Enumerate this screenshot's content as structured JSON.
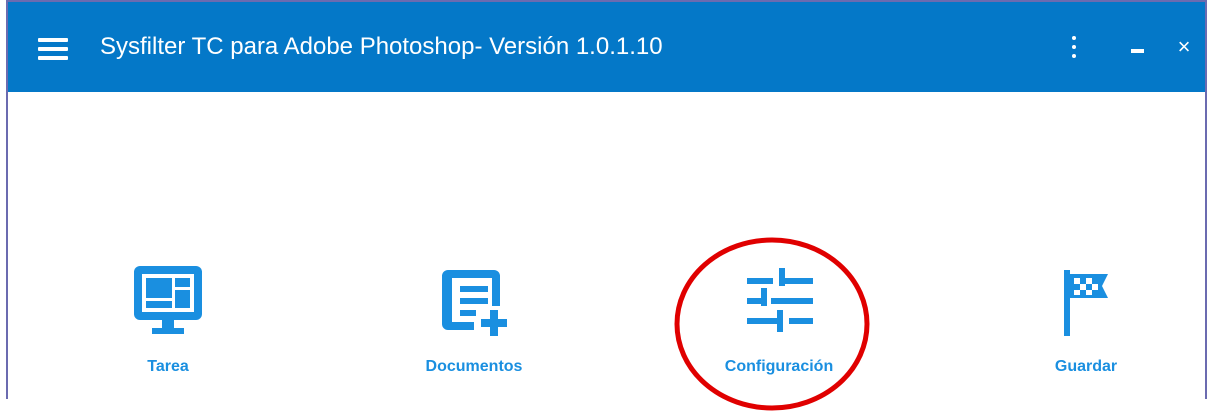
{
  "window": {
    "title": "Sysfilter TC para Adobe Photoshop- Versión 1.0.1.10",
    "close_glyph": "×"
  },
  "tools": [
    {
      "label": "Tarea",
      "icon": "monitor-icon"
    },
    {
      "label": "Documentos",
      "icon": "document-add-icon"
    },
    {
      "label": "Configuración",
      "icon": "sliders-icon"
    },
    {
      "label": "Guardar",
      "icon": "checkered-flag-icon"
    }
  ],
  "colors": {
    "titlebar": "#0478c8",
    "icon": "#1a8fe0",
    "highlight_circle": "#e00000"
  }
}
